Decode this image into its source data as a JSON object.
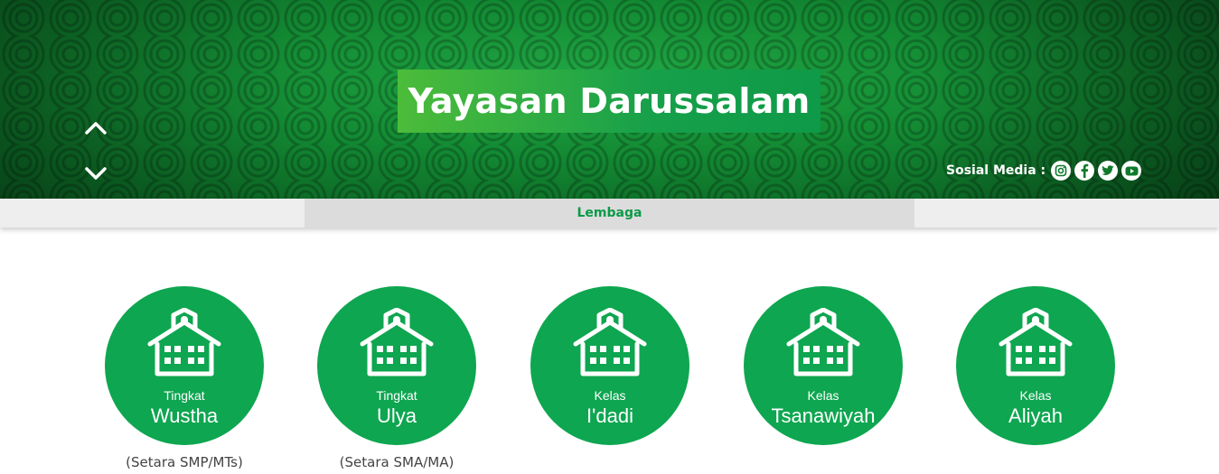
{
  "banner": {
    "title": "Yayasan Darussalam",
    "social_label": "Sosial Media :",
    "social_icons": [
      "instagram-icon",
      "facebook-icon",
      "twitter-icon",
      "youtube-icon"
    ]
  },
  "nav": {
    "active_tab": "Lembaga"
  },
  "institutions": [
    {
      "small": "Tingkat",
      "big": "Wustha",
      "caption": "(Setara SMP/MTs)"
    },
    {
      "small": "Tingkat",
      "big": "Ulya",
      "caption": "(Setara SMA/MA)"
    },
    {
      "small": "Kelas",
      "big": "I'dadi",
      "caption": ""
    },
    {
      "small": "Kelas",
      "big": "Tsanawiyah",
      "caption": ""
    },
    {
      "small": "Kelas",
      "big": "Aliyah",
      "caption": ""
    }
  ],
  "colors": {
    "brand_green": "#0ea650",
    "title_gradient_start": "#4cbc3a",
    "nav_active_text": "#0b9a48"
  }
}
